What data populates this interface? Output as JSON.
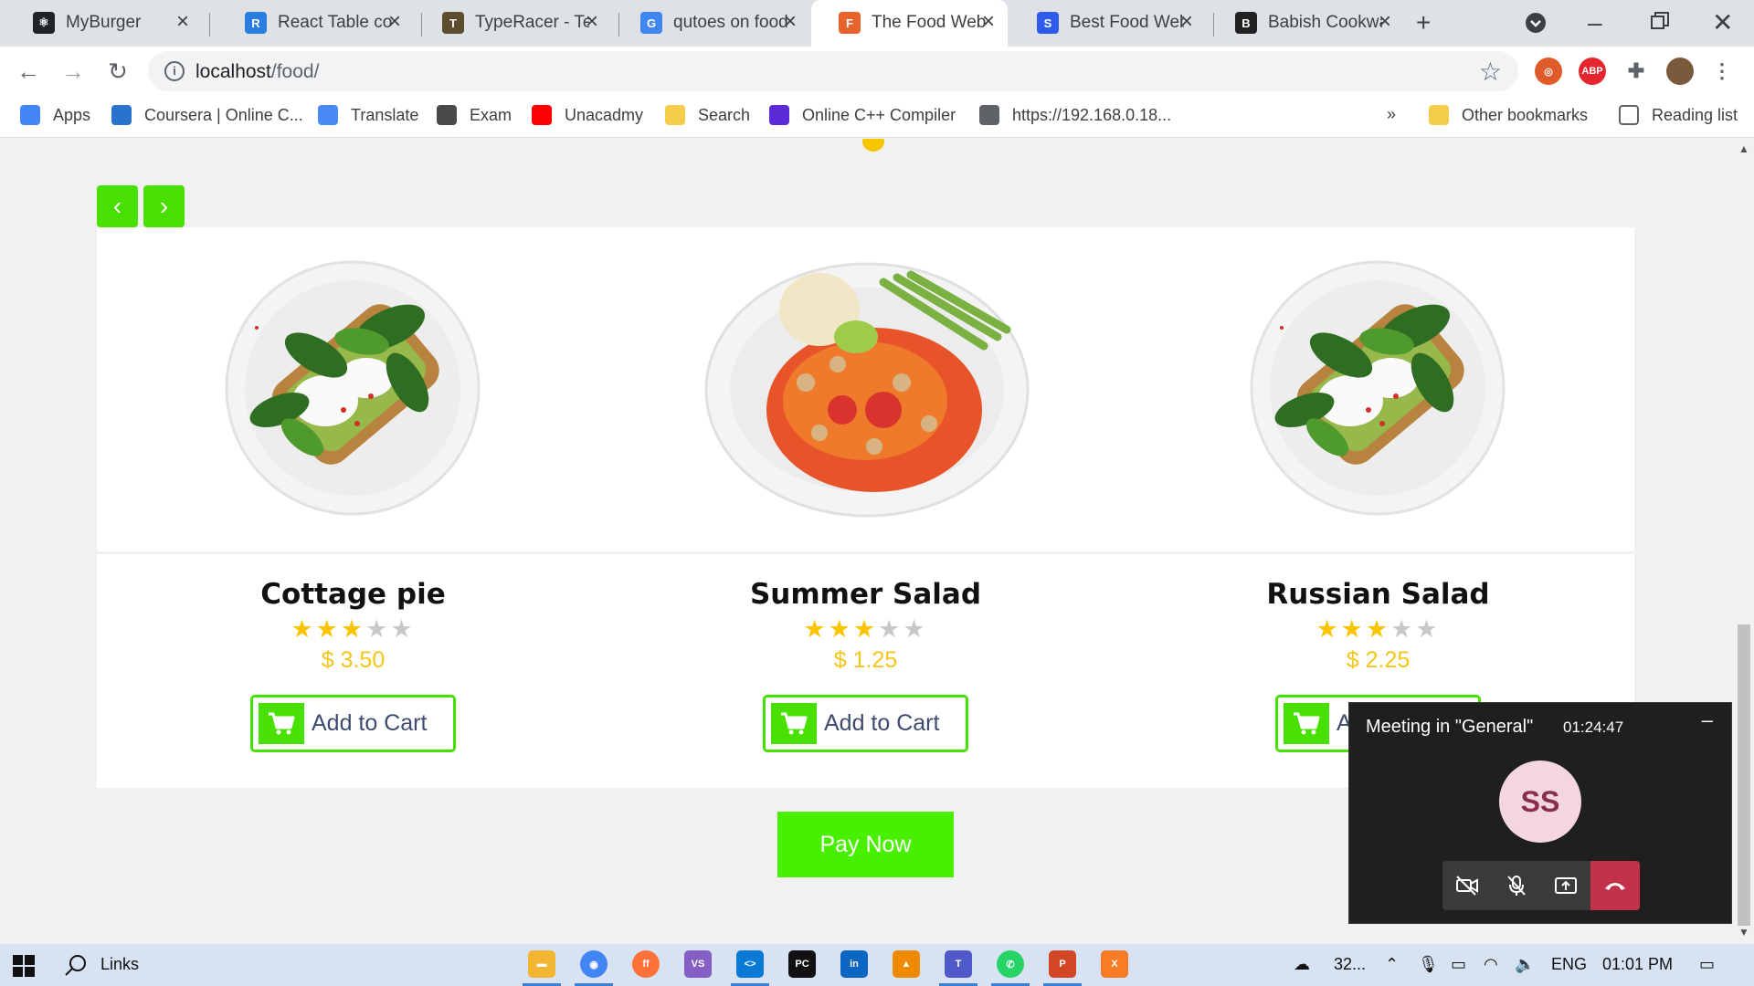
{
  "browser": {
    "tabs": [
      {
        "title": "MyBurger",
        "icon": "react-icon",
        "color": "#20232a",
        "glyph": "⚛"
      },
      {
        "title": "React Table con",
        "icon": "react-table-icon",
        "color": "#2a7de1",
        "glyph": "R"
      },
      {
        "title": "TypeRacer - Tes",
        "icon": "typeracer-icon",
        "color": "#5c4d2e",
        "glyph": "T"
      },
      {
        "title": "qutoes on food",
        "icon": "google-icon",
        "color": "#4285f4",
        "glyph": "G"
      },
      {
        "title": "The Food Web",
        "icon": "food-web-icon",
        "color": "#e8622c",
        "glyph": "F",
        "active": true
      },
      {
        "title": "Best Food Web",
        "icon": "s-icon",
        "color": "#2f5bea",
        "glyph": "S"
      },
      {
        "title": "Babish Cookwa",
        "icon": "babish-icon",
        "color": "#222222",
        "glyph": "B"
      }
    ],
    "new_tab": "+",
    "url_host": "localhost",
    "url_path": "/food/",
    "bookmarks": [
      {
        "label": "Apps",
        "icon": "apps-grid-icon",
        "color": "#4285f4"
      },
      {
        "label": "Coursera | Online C...",
        "icon": "coursera-icon",
        "color": "#2a73cc"
      },
      {
        "label": "Translate",
        "icon": "translate-icon",
        "color": "#4a8af4"
      },
      {
        "label": "Exam",
        "icon": "exam-icon",
        "color": "#4a4a4a"
      },
      {
        "label": "Unacadmy",
        "icon": "youtube-icon",
        "color": "#ff0000"
      },
      {
        "label": "Search",
        "icon": "folder-icon",
        "color": "#f6cd4a"
      },
      {
        "label": "Online C++ Compiler",
        "icon": "compiler-icon",
        "color": "#5b2bd8"
      },
      {
        "label": "https://192.168.0.18...",
        "icon": "globe-icon",
        "color": "#5f6368"
      }
    ],
    "bookmarks_more": "»",
    "other_bookmarks": "Other bookmarks",
    "reading_list": "Reading list"
  },
  "page": {
    "prev_label": "‹",
    "next_label": "›",
    "items": [
      {
        "name": "Cottage pie",
        "rating": 3,
        "max_rating": 5,
        "price": "$ 3.50",
        "cart_label": "Add to Cart",
        "dish": "avocado-toast"
      },
      {
        "name": "Summer Salad",
        "rating": 3,
        "max_rating": 5,
        "price": "$ 1.25",
        "cart_label": "Add to Cart",
        "dish": "papaya-salad"
      },
      {
        "name": "Russian Salad",
        "rating": 3,
        "max_rating": 5,
        "price": "$ 2.25",
        "cart_label": "Add to Cart",
        "dish": "avocado-toast"
      }
    ],
    "pay_label": "Pay Now"
  },
  "meeting": {
    "title": "Meeting in \"General\"",
    "timer": "01:24:47",
    "minimize": "–",
    "avatar_initials": "SS"
  },
  "taskbar": {
    "links_label": "Links",
    "weather": "32...",
    "language": "ENG",
    "time": "01:01 PM"
  },
  "colors": {
    "accent_green": "#48e000",
    "star_gold": "#fbc400",
    "price_gold": "#f5c518",
    "hangup_red": "#c4314b"
  }
}
